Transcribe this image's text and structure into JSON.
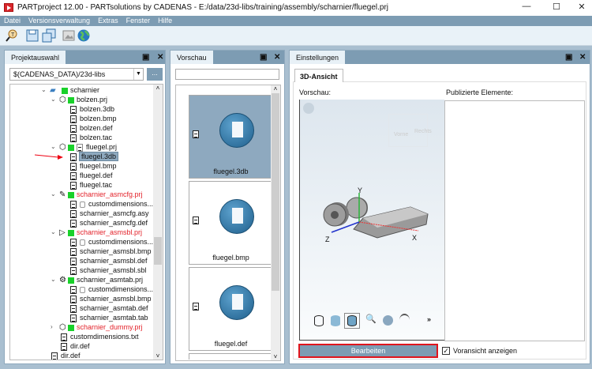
{
  "window": {
    "title": "PARTproject 12.00 - PARTsolutions by CADENAS - E:/data/23d-libs/training/assembly/scharnier/fluegel.prj",
    "minimize": "—",
    "maximize": "☐",
    "close": "✕"
  },
  "menu": [
    "Datei",
    "Versionsverwaltung",
    "Extras",
    "Fenster",
    "Hilfe"
  ],
  "toolbar": [
    "search-part-icon",
    "save-icon",
    "save-all-icon",
    "image-icon",
    "globe-icon"
  ],
  "left_panel": {
    "tab": "Projektauswahl",
    "path": "$(CADENAS_DATA)/23d-libs",
    "browse": "...",
    "tree": [
      {
        "label": "scharnier",
        "depth": 0,
        "type": "folder",
        "expanded": true
      },
      {
        "label": "bolzen.prj",
        "depth": 1,
        "type": "prj",
        "expanded": true
      },
      {
        "label": "bolzen.3db",
        "depth": 2,
        "type": "file"
      },
      {
        "label": "bolzen.bmp",
        "depth": 2,
        "type": "file"
      },
      {
        "label": "bolzen.def",
        "depth": 2,
        "type": "file"
      },
      {
        "label": "bolzen.tac",
        "depth": 2,
        "type": "file"
      },
      {
        "label": "fluegel.prj",
        "depth": 1,
        "type": "prj2",
        "expanded": true
      },
      {
        "label": "fluegel.3db",
        "depth": 2,
        "type": "file",
        "selected": true
      },
      {
        "label": "fluegel.bmp",
        "depth": 2,
        "type": "file"
      },
      {
        "label": "fluegel.def",
        "depth": 2,
        "type": "file"
      },
      {
        "label": "fluegel.tac",
        "depth": 2,
        "type": "file"
      },
      {
        "label": "scharnier_asmcfg.prj",
        "depth": 1,
        "type": "cfg",
        "expanded": true,
        "red": true
      },
      {
        "label": "customdimensions....",
        "depth": 2,
        "type": "lock"
      },
      {
        "label": "scharnier_asmcfg.asy",
        "depth": 2,
        "type": "file"
      },
      {
        "label": "scharnier_asmcfg.def",
        "depth": 2,
        "type": "file"
      },
      {
        "label": "scharnier_asmsbl.prj",
        "depth": 1,
        "type": "sbl",
        "expanded": true,
        "red": true
      },
      {
        "label": "customdimensions....",
        "depth": 2,
        "type": "lock"
      },
      {
        "label": "scharnier_asmsbl.bmp",
        "depth": 2,
        "type": "file"
      },
      {
        "label": "scharnier_asmsbl.def",
        "depth": 2,
        "type": "file"
      },
      {
        "label": "scharnier_asmsbl.sbl",
        "depth": 2,
        "type": "file"
      },
      {
        "label": "scharnier_asmtab.prj",
        "depth": 1,
        "type": "tab",
        "expanded": true
      },
      {
        "label": "customdimensions....",
        "depth": 2,
        "type": "lock"
      },
      {
        "label": "scharnier_asmsbl.bmp",
        "depth": 2,
        "type": "file"
      },
      {
        "label": "scharnier_asmtab.def",
        "depth": 2,
        "type": "file"
      },
      {
        "label": "scharnier_asmtab.tab",
        "depth": 2,
        "type": "file"
      },
      {
        "label": "scharnier_dummy.prj",
        "depth": 1,
        "type": "prj",
        "expanded": false,
        "red": true
      },
      {
        "label": "customdimensions.txt",
        "depth": 1,
        "type": "file"
      },
      {
        "label": "dir.def",
        "depth": 1,
        "type": "file"
      },
      {
        "label": "dir.def",
        "depth": -1,
        "type": "file"
      }
    ]
  },
  "middle_panel": {
    "tab": "Vorschau",
    "search": "",
    "thumbs": [
      {
        "label": "fluegel.3db",
        "selected": true
      },
      {
        "label": "fluegel.bmp"
      },
      {
        "label": "fluegel.def"
      }
    ]
  },
  "right_panel": {
    "tab": "Einstellungen",
    "subtab": "3D-Ansicht",
    "preview_label": "Vorschau:",
    "published_label": "Publizierte Elemente:",
    "axes": {
      "x": "X",
      "y": "Y",
      "z": "Z"
    },
    "viewcube": {
      "front": "Vorne",
      "right": "Rechts"
    },
    "more": "»",
    "edit_button": "Bearbeiten",
    "checkbox_label": "Voransicht anzeigen",
    "checkbox_checked": true
  }
}
